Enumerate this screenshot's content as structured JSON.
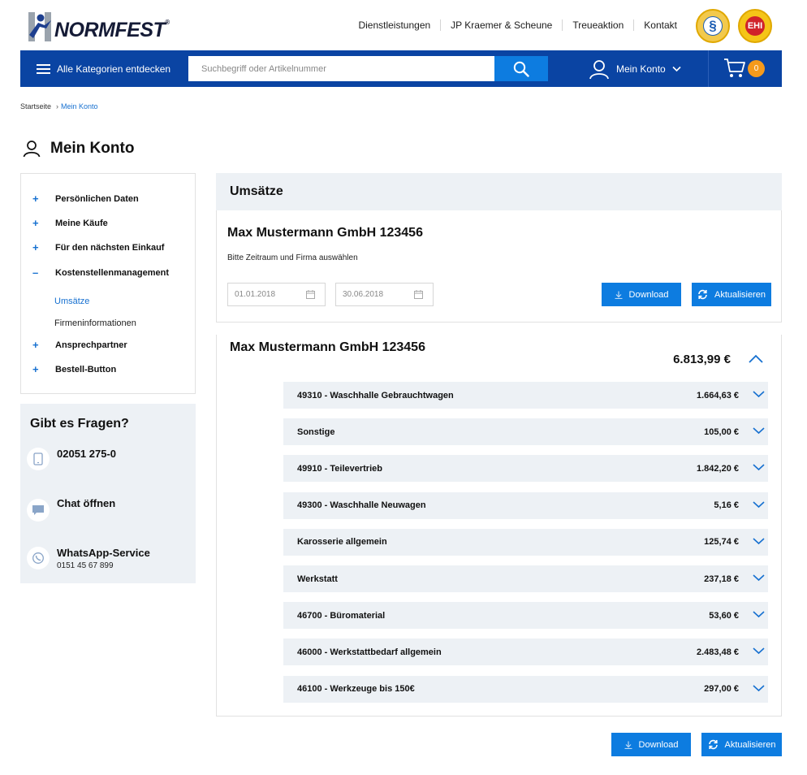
{
  "header": {
    "logo_text": "NORMFEST",
    "logo_reg": "®",
    "topnav": [
      "Dienstleistungen",
      "JP Kraemer & Scheune",
      "Treueaktion",
      "Kontakt"
    ],
    "seal1_symbol": "§",
    "seal2_symbol": "EHI"
  },
  "navbar": {
    "categories_label": "Alle Kategorien entdecken",
    "search_placeholder": "Suchbegriff oder Artikelnummer",
    "account_label": "Mein Konto",
    "cart_count": "0"
  },
  "breadcrumb": [
    "Startseite",
    "›",
    "Mein Konto"
  ],
  "page_title": "Mein Konto",
  "sidebar": {
    "items": [
      {
        "symbol": "+",
        "label": "Persönlichen Daten"
      },
      {
        "symbol": "+",
        "label": "Meine Käufe"
      },
      {
        "symbol": "+",
        "label": "Für den nächsten Einkauf"
      },
      {
        "symbol": "–",
        "label": "Kostenstellenmanagement"
      }
    ],
    "subitems": [
      {
        "label": "Umsätze",
        "active": true
      },
      {
        "label": "Firmeninformationen",
        "active": false
      }
    ],
    "items_after": [
      {
        "symbol": "+",
        "label": "Ansprechpartner"
      },
      {
        "symbol": "+",
        "label": "Bestell-Button"
      }
    ]
  },
  "help": {
    "title": "Gibt es Fragen?",
    "phone": "02051 275-0",
    "chat": "Chat öffnen",
    "whatsapp_title": "WhatsApp-Service",
    "whatsapp_number": "0151 45 67 899"
  },
  "umsatze": {
    "heading": "Umsätze",
    "company": "Max Mustermann GmbH 123456",
    "hint": "Bitte Zeitraum und Firma auswählen",
    "date_from": "01.01.2018",
    "date_to": "30.06.2018",
    "download_label": "Download",
    "refresh_label": "Aktualisieren"
  },
  "result": {
    "company": "Max Mustermann GmbH 123456",
    "total": "6.813,99 €",
    "rows": [
      {
        "name": "49310 - Waschhalle Gebrauchtwagen",
        "amount": "1.664,63 €"
      },
      {
        "name": "Sonstige",
        "amount": "105,00 €"
      },
      {
        "name": "49910 - Teilevertrieb",
        "amount": "1.842,20 €"
      },
      {
        "name": "49300 - Waschhalle Neuwagen",
        "amount": "5,16 €"
      },
      {
        "name": "Karosserie allgemein",
        "amount": "125,74 €"
      },
      {
        "name": "Werkstatt",
        "amount": "237,18 €"
      },
      {
        "name": "46700 - Büromaterial",
        "amount": "53,60 €"
      },
      {
        "name": "46000 - Werkstattbedarf allgemein",
        "amount": "2.483,48 €"
      },
      {
        "name": "46100 - Werkzeuge bis 150€",
        "amount": "297,00 €"
      }
    ]
  },
  "footer_actions": {
    "download_label": "Download",
    "refresh_label": "Aktualisieren"
  },
  "colors": {
    "brand_blue": "#0a44a3",
    "accent_blue": "#0d7ce0",
    "cart_orange": "#f59a1c",
    "panel_gray": "#edf1f5"
  }
}
